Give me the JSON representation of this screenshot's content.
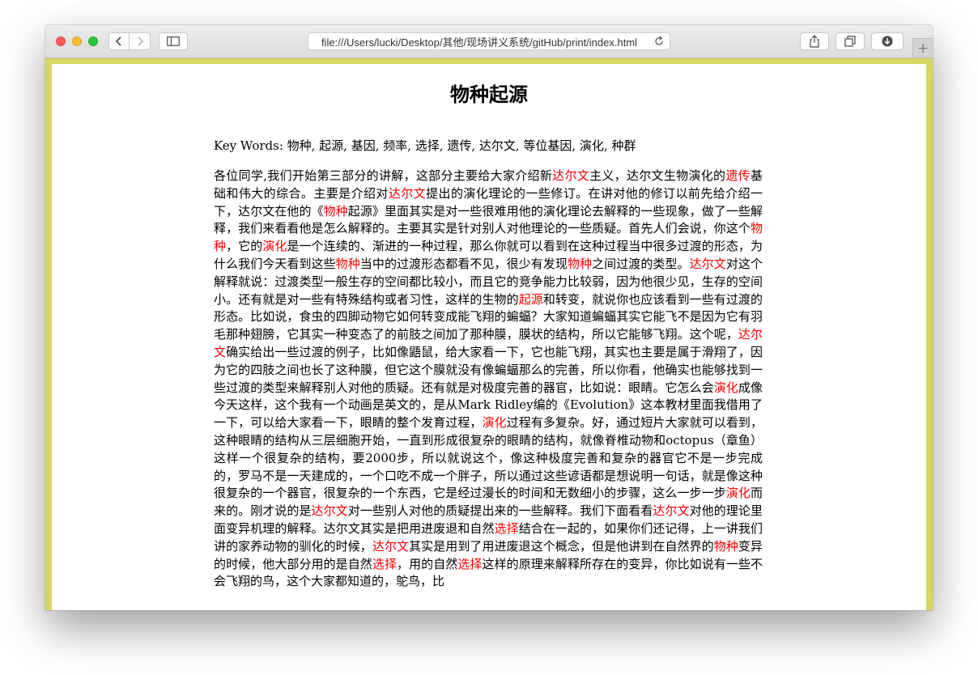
{
  "browser": {
    "url": "file:///Users/lucki/Desktop/其他/现场讲义系统/gitHub/print/index.html",
    "icons": [
      "close-icon",
      "minimize-icon",
      "maximize-icon",
      "chevron-left-icon",
      "chevron-right-icon",
      "sidebar-icon",
      "reload-icon",
      "share-icon",
      "tabs-icon",
      "download-icon",
      "plus-icon"
    ],
    "new_tab_symbol": "+"
  },
  "colors": {
    "page_background": "#d6d660",
    "highlight": "#ff0000"
  },
  "page": {
    "title": "物种起源",
    "keywords": "Key Words: 物种, 起源, 基因, 频率, 选择, 遗传, 达尔文, 等位基因, 演化, 种群",
    "segments": [
      {
        "t": "各位同学,我们开始第三部分的讲解，这部分主要给大家介绍新",
        "hl": false
      },
      {
        "t": "达尔文",
        "hl": true
      },
      {
        "t": "主义，达尔文生物演化的",
        "hl": false
      },
      {
        "t": "遗传",
        "hl": true
      },
      {
        "t": "基础和伟大的综合。主要是介绍对",
        "hl": false
      },
      {
        "t": "达尔文",
        "hl": true
      },
      {
        "t": "提出的演化理论的一些修订。在讲对他的修订以前先给介绍一下，达尔文在他的《",
        "hl": false
      },
      {
        "t": "物种",
        "hl": true
      },
      {
        "t": "起源》里面其实是对一些很难用他的演化理论去解释的一些现象，做了一些解释，我们来看看他是怎么解释的。主要其实是针对别人对他理论的一些质疑。首先人们会说，你这个",
        "hl": false
      },
      {
        "t": "物种",
        "hl": true
      },
      {
        "t": "，它的",
        "hl": false
      },
      {
        "t": "演化",
        "hl": true
      },
      {
        "t": "是一个连续的、渐进的一种过程，那么你就可以看到在这种过程当中很多过渡的形态，为什么我们今天看到这些",
        "hl": false
      },
      {
        "t": "物种",
        "hl": true
      },
      {
        "t": "当中的过渡形态都看不见，很少有发现",
        "hl": false
      },
      {
        "t": "物种",
        "hl": true
      },
      {
        "t": "之间过渡的类型。",
        "hl": false
      },
      {
        "t": "达尔文",
        "hl": true
      },
      {
        "t": "对这个解释就说：过渡类型一般生存的空间都比较小，而且它的竞争能力比较弱，因为他很少见，生存的空间小。还有就是对一些有特殊结构或者习性，这样的生物的",
        "hl": false
      },
      {
        "t": "起源",
        "hl": true
      },
      {
        "t": "和转变，就说你也应该看到一些有过渡的形态。比如说，食虫的四脚动物它如何转变成能飞翔的蝙蝠？大家知道蝙蝠其实它能飞不是因为它有羽毛那种翅膀，它其实一种变态了的前肢之间加了那种膜，膜状的结构，所以它能够飞翔。这个呢，",
        "hl": false
      },
      {
        "t": "达尔文",
        "hl": true
      },
      {
        "t": "确实给出一些过渡的例子，比如像鼯鼠，给大家看一下，它也能飞翔，其实也主要是属于滑翔了，因为它的四肢之间也长了这种膜，但它这个膜就没有像蝙蝠那么的完善，所以你看，他确实也能够找到一些过渡的类型来解释别人对他的质疑。还有就是对极度完善的器官，比如说：眼睛。它怎么会",
        "hl": false
      },
      {
        "t": "演化",
        "hl": true
      },
      {
        "t": "成像今天这样，这个我有一个动画是英文的，是从Mark Ridley编的《Evolution》这本教材里面我借用了一下，可以给大家看一下，眼睛的整个发育过程，",
        "hl": false
      },
      {
        "t": "演化",
        "hl": true
      },
      {
        "t": "过程有多复杂。好，通过短片大家就可以看到，这种眼睛的结构从三层细胞开始，一直到形成很复杂的眼睛的结构，就像脊椎动物和octopus（章鱼）这样一个很复杂的结构，要2000步，所以就说这个，像这种极度完善和复杂的器官它不是一步完成的，罗马不是一天建成的，一个口吃不成一个胖子，所以通过这些谚语都是想说明一句话，就是像这种很复杂的一个器官，很复杂的一个东西，它是经过漫长的时间和无数细小的步骤，这么一步一步",
        "hl": false
      },
      {
        "t": "演化",
        "hl": true
      },
      {
        "t": "而来的。刚才说的是",
        "hl": false
      },
      {
        "t": "达尔文",
        "hl": true
      },
      {
        "t": "对一些别人对他的质疑提出来的一些解释。我们下面看看",
        "hl": false
      },
      {
        "t": "达尔文",
        "hl": true
      },
      {
        "t": "对他的理论里面变异机理的解释。达尔文其实是把用进废退和自然",
        "hl": false
      },
      {
        "t": "选择",
        "hl": true
      },
      {
        "t": "结合在一起的，如果你们还记得，上一讲我们讲的家养动物的驯化的时候，",
        "hl": false
      },
      {
        "t": "达尔文",
        "hl": true
      },
      {
        "t": "其实是用到了用进废退这个概念，但是他讲到在自然界的",
        "hl": false
      },
      {
        "t": "物种",
        "hl": true
      },
      {
        "t": "变异的时候，他大部分用的是自然",
        "hl": false
      },
      {
        "t": "选择",
        "hl": true
      },
      {
        "t": "，用的自然",
        "hl": false
      },
      {
        "t": "选择",
        "hl": true
      },
      {
        "t": "这样的原理来解释所存在的变异，你比如说有一些不会飞翔的鸟，这个大家都知道的，鸵鸟，比",
        "hl": false
      }
    ]
  }
}
